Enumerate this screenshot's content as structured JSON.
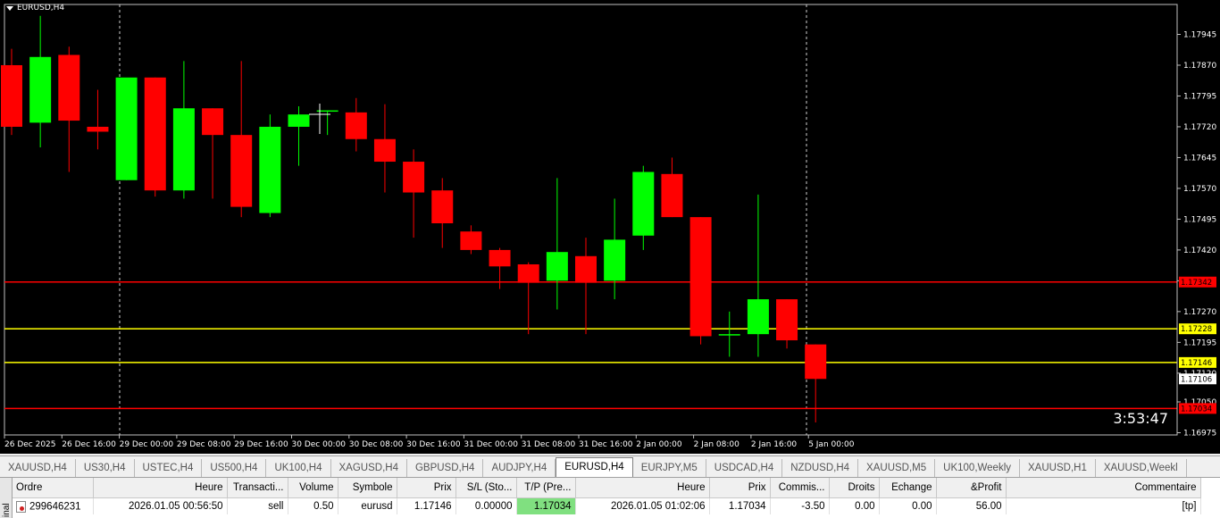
{
  "chart": {
    "symbol_label": "EURUSD,H4",
    "countdown": "3:53:47",
    "colors": {
      "bull": "#00ff00",
      "bear": "#ff0000",
      "background": "#000000",
      "sl_line": "#ff0000",
      "order_line": "#ffff00"
    },
    "price_ticks": [
      "1.17945",
      "1.17870",
      "1.17795",
      "1.17720",
      "1.17645",
      "1.17570",
      "1.17495",
      "1.17420",
      "1.17345",
      "1.17270",
      "1.17195",
      "1.17120",
      "1.17050",
      "1.16975"
    ],
    "time_labels": [
      "26 Dec 2025",
      "26 Dec 16:00",
      "29 Dec 00:00",
      "29 Dec 08:00",
      "29 Dec 16:00",
      "30 Dec 00:00",
      "30 Dec 08:00",
      "30 Dec 16:00",
      "31 Dec 00:00",
      "31 Dec 08:00",
      "31 Dec 16:00",
      "2 Jan 00:00",
      "2 Jan 08:00",
      "2 Jan 16:00",
      "5 Jan 00:00"
    ],
    "price_tags": [
      {
        "label": "1.17342",
        "value": 1.17342,
        "kind": "red"
      },
      {
        "label": "1.17228",
        "value": 1.17228,
        "kind": "yellow"
      },
      {
        "label": "1.17146",
        "value": 1.17146,
        "kind": "yellow"
      },
      {
        "label": "1.17106",
        "value": 1.17106,
        "kind": "white"
      },
      {
        "label": "1.17034",
        "value": 1.17034,
        "kind": "red"
      }
    ],
    "horizontal_lines": [
      {
        "value": 1.17342,
        "color": "#ff0000"
      },
      {
        "value": 1.17228,
        "color": "#ffff00"
      },
      {
        "value": 1.17146,
        "color": "#ffff00"
      },
      {
        "value": 1.17034,
        "color": "#ff0000"
      }
    ],
    "chart_data": {
      "type": "candlestick",
      "ylim": [
        1.16975,
        1.17945
      ],
      "candles": [
        {
          "o": 1.1787,
          "h": 1.1791,
          "l": 1.177,
          "c": 1.1772
        },
        {
          "o": 1.1773,
          "h": 1.1799,
          "l": 1.1767,
          "c": 1.1789
        },
        {
          "o": 1.17895,
          "h": 1.17915,
          "l": 1.1761,
          "c": 1.17735
        },
        {
          "o": 1.1772,
          "h": 1.1781,
          "l": 1.17665,
          "c": 1.17708
        },
        {
          "o": 1.1759,
          "h": 1.17835,
          "l": 1.1759,
          "c": 1.1784
        },
        {
          "o": 1.1784,
          "h": 1.1784,
          "l": 1.1755,
          "c": 1.17565
        },
        {
          "o": 1.17565,
          "h": 1.1788,
          "l": 1.17545,
          "c": 1.17765
        },
        {
          "o": 1.17765,
          "h": 1.17765,
          "l": 1.17545,
          "c": 1.177
        },
        {
          "o": 1.177,
          "h": 1.1788,
          "l": 1.175,
          "c": 1.17525
        },
        {
          "o": 1.1751,
          "h": 1.1775,
          "l": 1.175,
          "c": 1.1772
        },
        {
          "o": 1.1772,
          "h": 1.1777,
          "l": 1.17625,
          "c": 1.1775
        },
        {
          "o": 1.1776,
          "h": 1.1776,
          "l": 1.177,
          "c": 1.1776
        },
        {
          "o": 1.17755,
          "h": 1.1779,
          "l": 1.1766,
          "c": 1.1769
        },
        {
          "o": 1.1769,
          "h": 1.17775,
          "l": 1.1756,
          "c": 1.17635
        },
        {
          "o": 1.17635,
          "h": 1.17665,
          "l": 1.1745,
          "c": 1.1756
        },
        {
          "o": 1.17565,
          "h": 1.17595,
          "l": 1.17425,
          "c": 1.17485
        },
        {
          "o": 1.17465,
          "h": 1.1748,
          "l": 1.1741,
          "c": 1.1742
        },
        {
          "o": 1.1742,
          "h": 1.17425,
          "l": 1.17325,
          "c": 1.1738
        },
        {
          "o": 1.17385,
          "h": 1.1739,
          "l": 1.17215,
          "c": 1.1734
        },
        {
          "o": 1.17345,
          "h": 1.17595,
          "l": 1.17275,
          "c": 1.17415
        },
        {
          "o": 1.17405,
          "h": 1.1745,
          "l": 1.17215,
          "c": 1.1734
        },
        {
          "o": 1.17345,
          "h": 1.17545,
          "l": 1.173,
          "c": 1.17445
        },
        {
          "o": 1.17455,
          "h": 1.17625,
          "l": 1.1742,
          "c": 1.1761
        },
        {
          "o": 1.17605,
          "h": 1.17645,
          "l": 1.175,
          "c": 1.175
        },
        {
          "o": 1.175,
          "h": 1.175,
          "l": 1.1719,
          "c": 1.1721
        },
        {
          "o": 1.17215,
          "h": 1.1727,
          "l": 1.1716,
          "c": 1.17215
        },
        {
          "o": 1.17215,
          "h": 1.17555,
          "l": 1.1716,
          "c": 1.173
        },
        {
          "o": 1.173,
          "h": 1.173,
          "l": 1.1718,
          "c": 1.172
        },
        {
          "o": 1.1719,
          "h": 1.1719,
          "l": 1.17,
          "c": 1.17106
        }
      ]
    }
  },
  "tabs": {
    "items": [
      "XAUUSD,H4",
      "US30,H4",
      "USTEC,H4",
      "US500,H4",
      "UK100,H4",
      "XAGUSD,H4",
      "GBPUSD,H4",
      "AUDJPY,H4",
      "EURUSD,H4",
      "EURJPY,M5",
      "USDCAD,H4",
      "NZDUSD,H4",
      "XAUUSD,M5",
      "UK100,Weekly",
      "XAUUSD,H1",
      "XAUUSD,Weekl"
    ],
    "active_index": 8
  },
  "terminal": {
    "side_label": "inal",
    "headers": [
      "Ordre",
      "Heure",
      "Transacti...",
      "Volume",
      "Symbole",
      "Prix",
      "S/L (Sto...",
      "T/P (Pre...",
      "Heure",
      "Prix",
      "Commis...",
      "Droits",
      "Echange",
      "&Profit",
      "Commentaire"
    ],
    "rows": [
      [
        "299646231",
        "2026.01.05 00:56:50",
        "sell",
        "0.50",
        "eurusd",
        "1.17146",
        "0.00000",
        "1.17034",
        "2026.01.05 01:02:06",
        "1.17034",
        "-3.50",
        "0.00",
        "0.00",
        "56.00",
        "[tp]"
      ]
    ]
  }
}
